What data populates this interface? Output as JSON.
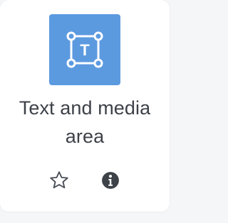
{
  "item": {
    "title_line1": "Text and media",
    "title_line2": "area",
    "icon": "text-box-icon",
    "icon_letter": "T",
    "tile_color": "#5c9ae0"
  },
  "actions": {
    "star_icon": "star-outline-icon",
    "info_icon": "info-circle-icon"
  }
}
